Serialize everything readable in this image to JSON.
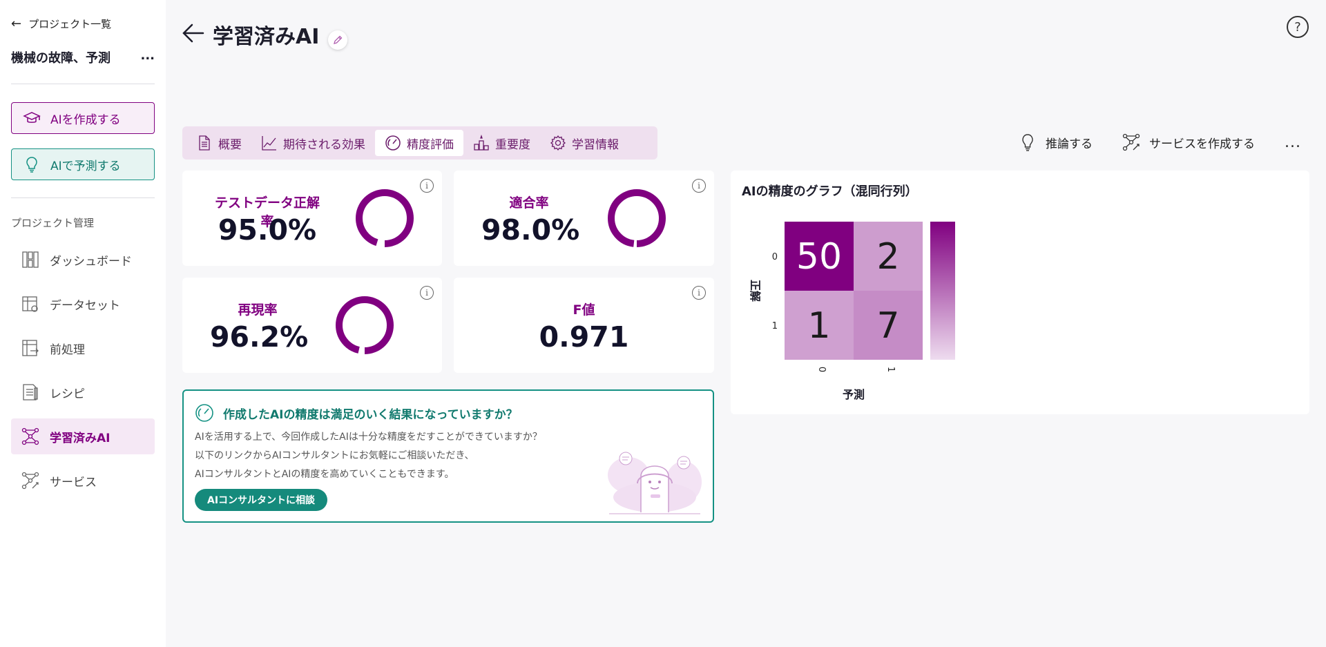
{
  "sidebar": {
    "back_label": "プロジェクト一覧",
    "project_name": "機械の故障、予測",
    "project_more": "...",
    "create_ai": "AIを作成する",
    "predict_ai": "AIで予測する",
    "section_label": "プロジェクト管理",
    "items": [
      {
        "label": "ダッシュボード",
        "icon": "dashboard-icon"
      },
      {
        "label": "データセット",
        "icon": "dataset-icon"
      },
      {
        "label": "前処理",
        "icon": "preprocess-icon"
      },
      {
        "label": "レシピ",
        "icon": "recipe-icon"
      },
      {
        "label": "学習済みAI",
        "icon": "trained-ai-icon",
        "active": true
      },
      {
        "label": "サービス",
        "icon": "service-icon"
      }
    ]
  },
  "header": {
    "title": "学習済みAI",
    "help": "?"
  },
  "tabs": [
    {
      "label": "概要",
      "icon": "document-icon"
    },
    {
      "label": "期待される効果",
      "icon": "trend-icon"
    },
    {
      "label": "精度評価",
      "icon": "gauge-icon",
      "active": true
    },
    {
      "label": "重要度",
      "icon": "podium-icon"
    },
    {
      "label": "学習情報",
      "icon": "gear-icon"
    }
  ],
  "actions": {
    "infer": "推論する",
    "create_service": "サービスを作成する",
    "more": "..."
  },
  "metrics": {
    "accuracy": {
      "label": "テストデータ正解率",
      "value": "95.0%",
      "fraction": 0.95
    },
    "precision": {
      "label": "適合率",
      "value": "98.0%",
      "fraction": 0.98
    },
    "recall": {
      "label": "再現率",
      "value": "96.2%",
      "fraction": 0.962
    },
    "f1": {
      "label": "F値",
      "value": "0.971"
    },
    "info": "i"
  },
  "consult": {
    "title": "作成したAIの精度は満足のいく結果になっていますか？",
    "line1": "AIを活用する上で、今回作成したAIは十分な精度をだすことができていますか？",
    "line2": "以下のリンクからAIコンサルタントにお気軽にご相談いただき、",
    "line3": "AIコンサルタントとAIの精度を高めていくこともできます。",
    "button": "AIコンサルタントに相談"
  },
  "chart_data": {
    "type": "heatmap",
    "title": "AIの精度のグラフ（混同行列）",
    "xlabel": "予測",
    "ylabel": "正解",
    "x_categories": [
      "0",
      "1"
    ],
    "y_categories": [
      "0",
      "1"
    ],
    "values": [
      [
        50,
        2
      ],
      [
        1,
        7
      ]
    ],
    "colors": {
      "high": "#800080",
      "low": "#cfa0d0"
    }
  },
  "colors": {
    "accent": "#800080",
    "teal": "#149183"
  }
}
